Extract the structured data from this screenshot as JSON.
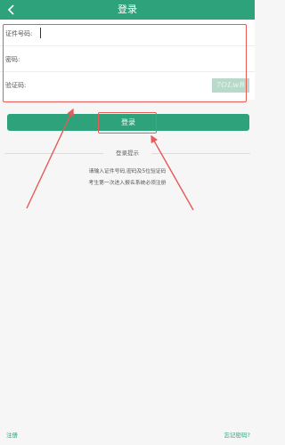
{
  "header": {
    "title": "登录"
  },
  "form": {
    "id_label": "证件号码:",
    "password_label": "密码:",
    "captcha_label": "验证码:",
    "captcha_text": "7OLwR"
  },
  "login_button": {
    "label": "登录"
  },
  "hint": {
    "title": "登录提示",
    "line1": "请输入证件号码,密码及5位验证码",
    "line2": "考生第一次进入报名系统必须注册"
  },
  "footer": {
    "register": "注册",
    "forgot": "忘记密码?"
  },
  "colors": {
    "brand": "#2ea27a",
    "annotation": "#e85a58"
  },
  "icons": {
    "back": "chevron-left-icon"
  }
}
